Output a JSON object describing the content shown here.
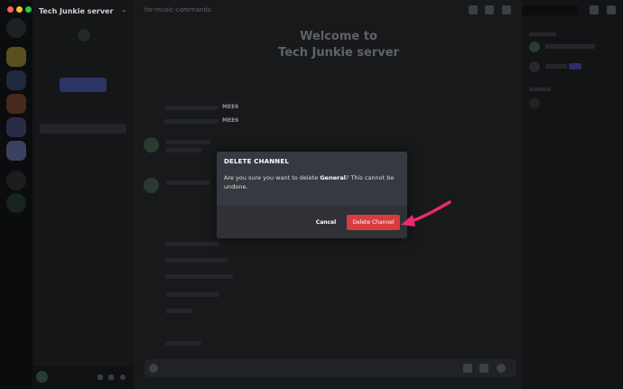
{
  "server": {
    "name": "Tech Junkie server"
  },
  "channel_header": "for-music-commands",
  "welcome": {
    "title_line1": "Welcome to",
    "title_line2": "Tech Junkie server"
  },
  "messages": {
    "mee6_a": "MEE6",
    "mee6_b": "MEE6"
  },
  "dialog": {
    "title": "DELETE CHANNEL",
    "body_prefix": "Are you sure you want to delete ",
    "channel_name": "General",
    "body_suffix": "? This cannot be undone.",
    "cancel_label": "Cancel",
    "confirm_label": "Delete Channel"
  },
  "colors": {
    "danger": "#d83c3e",
    "modal_bg": "#36393f",
    "modal_footer": "#2f3136",
    "annotation_arrow": "#ec2a6a"
  },
  "icons": [
    "close-dot",
    "minimize-dot",
    "maximize-dot",
    "chevron-down-icon",
    "hash-icon",
    "bell-icon",
    "pin-icon",
    "members-icon",
    "inbox-icon",
    "help-icon",
    "mic-icon",
    "headphones-icon",
    "gear-icon",
    "gift-icon",
    "emoji-icon",
    "plus-icon"
  ]
}
